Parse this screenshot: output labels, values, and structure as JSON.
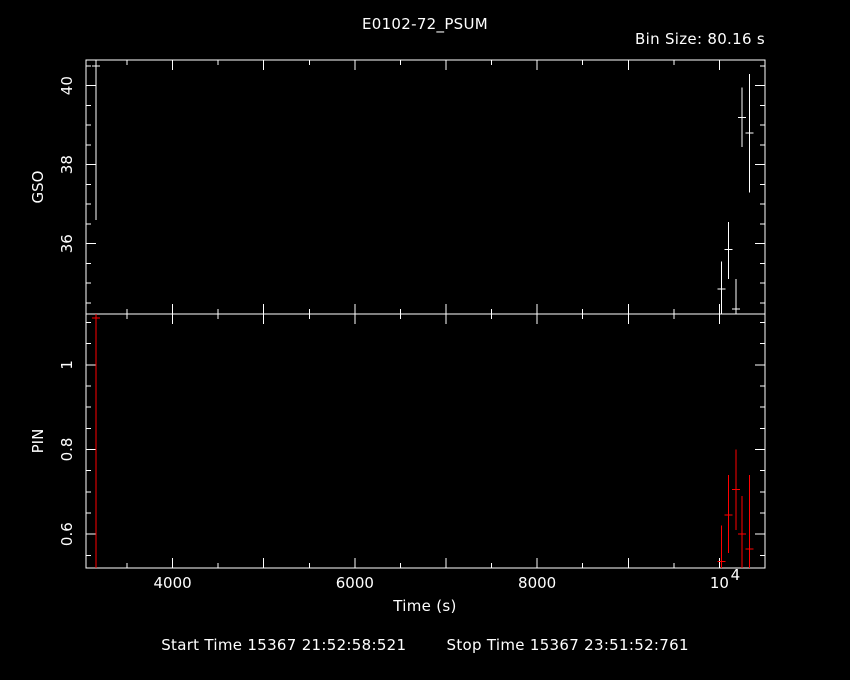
{
  "colors": {
    "background": "#000000",
    "axes": "#ffffff",
    "gso": "#ffffff",
    "pin": "#ff0000"
  },
  "header": {
    "title": "E0102-72_PSUM",
    "bin_size_label": "Bin Size:",
    "bin_size_value": "80.16 s"
  },
  "footer": {
    "start_label": "Start Time",
    "start_value": "15367 21:52:58:521",
    "stop_label": "Stop Time",
    "stop_value": "15367 23:51:52:761"
  },
  "chart_data": [
    {
      "type": "scatter",
      "panel": "top",
      "title": "E0102-72_PSUM",
      "xlabel": "Time (s)",
      "ylabel": "GSO",
      "xlim": [
        3050,
        10500
      ],
      "ylim": [
        34.22,
        40.65
      ],
      "x_ticks": [
        4000,
        6000,
        8000,
        10000
      ],
      "y_ticks": [
        36,
        38,
        40
      ],
      "y_tick_labels": [
        "36",
        "38",
        "40"
      ],
      "grid": false,
      "error_bars": true,
      "series": [
        {
          "color": "#ffffff",
          "points": [
            {
              "x": 3160,
              "y": 40.5,
              "ylo": 36.6,
              "yhi": 40.65
            },
            {
              "x": 10020,
              "y": 34.85,
              "ylo": 34.22,
              "yhi": 35.55
            },
            {
              "x": 10100,
              "y": 35.85,
              "ylo": 35.1,
              "yhi": 36.55
            },
            {
              "x": 10180,
              "y": 34.35,
              "ylo": 34.22,
              "yhi": 35.1
            },
            {
              "x": 10250,
              "y": 39.2,
              "ylo": 38.45,
              "yhi": 39.95
            },
            {
              "x": 10330,
              "y": 38.8,
              "ylo": 37.3,
              "yhi": 40.3
            }
          ]
        }
      ]
    },
    {
      "type": "scatter",
      "panel": "bottom",
      "xlabel": "Time (s)",
      "ylabel": "PIN",
      "xlim": [
        3050,
        10500
      ],
      "ylim": [
        0.52,
        1.12
      ],
      "x_ticks": [
        4000,
        6000,
        8000,
        10000
      ],
      "x_tick_labels": [
        "4000",
        "6000",
        "8000",
        "10"
      ],
      "x_tick_exponent": "4",
      "y_ticks": [
        0.6,
        0.8,
        1.0
      ],
      "y_tick_labels": [
        "0.6",
        "0.8",
        "1"
      ],
      "grid": false,
      "error_bars": true,
      "series": [
        {
          "color": "#ff0000",
          "points": [
            {
              "x": 3160,
              "y": 1.11,
              "ylo": 0.52,
              "yhi": 1.12
            },
            {
              "x": 10020,
              "y": 0.535,
              "ylo": 0.52,
              "yhi": 0.62
            },
            {
              "x": 10100,
              "y": 0.645,
              "ylo": 0.555,
              "yhi": 0.74
            },
            {
              "x": 10180,
              "y": 0.705,
              "ylo": 0.61,
              "yhi": 0.8
            },
            {
              "x": 10250,
              "y": 0.6,
              "ylo": 0.52,
              "yhi": 0.69
            },
            {
              "x": 10330,
              "y": 0.565,
              "ylo": 0.52,
              "yhi": 0.74
            }
          ]
        }
      ]
    }
  ]
}
